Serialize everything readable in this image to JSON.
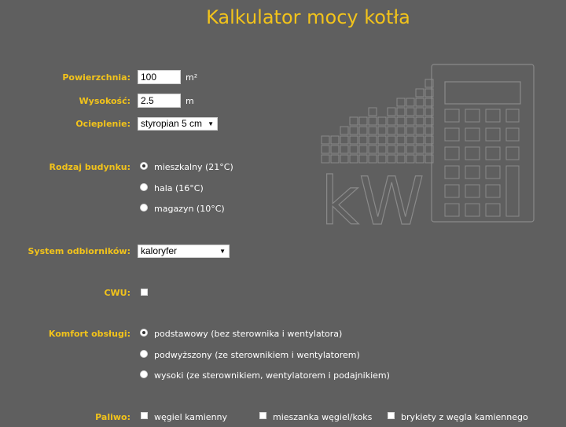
{
  "title": "Kalkulator mocy kotła",
  "fields": {
    "area": {
      "label": "Powierzchnia:",
      "value": "100",
      "unit": "m²"
    },
    "height": {
      "label": "Wysokość:",
      "value": "2.5",
      "unit": "m"
    },
    "insulation": {
      "label": "Ocieplenie:",
      "selected": "styropian 5 cm"
    },
    "building_type": {
      "label": "Rodzaj budynku:",
      "options": [
        "mieszkalny (21°C)",
        "hala (16°C)",
        "magazyn (10°C)"
      ],
      "selected_index": 0
    },
    "receivers": {
      "label": "System odbiorników:",
      "selected": "kaloryfer"
    },
    "cwu": {
      "label": "CWU:",
      "checked": false
    },
    "comfort": {
      "label": "Komfort obsługi:",
      "options": [
        "podstawowy (bez sterownika i wentylatora)",
        "podwyższony (ze sterownikiem i wentylatorem)",
        "wysoki (ze sterownikiem, wentylatorem i podajnikiem)"
      ],
      "selected_index": 0
    },
    "fuel": {
      "label": "Paliwo:",
      "options": [
        "węgiel kamienny",
        "mieszanka węgiel/koks",
        "brykiety z węgla kamiennego"
      ]
    }
  },
  "colors": {
    "background": "#5f5f5f",
    "accent": "#f2c31b",
    "decor": "#8a8a8a"
  },
  "decoration": {
    "icon": "kw-calculator-icon",
    "text": "kW"
  }
}
